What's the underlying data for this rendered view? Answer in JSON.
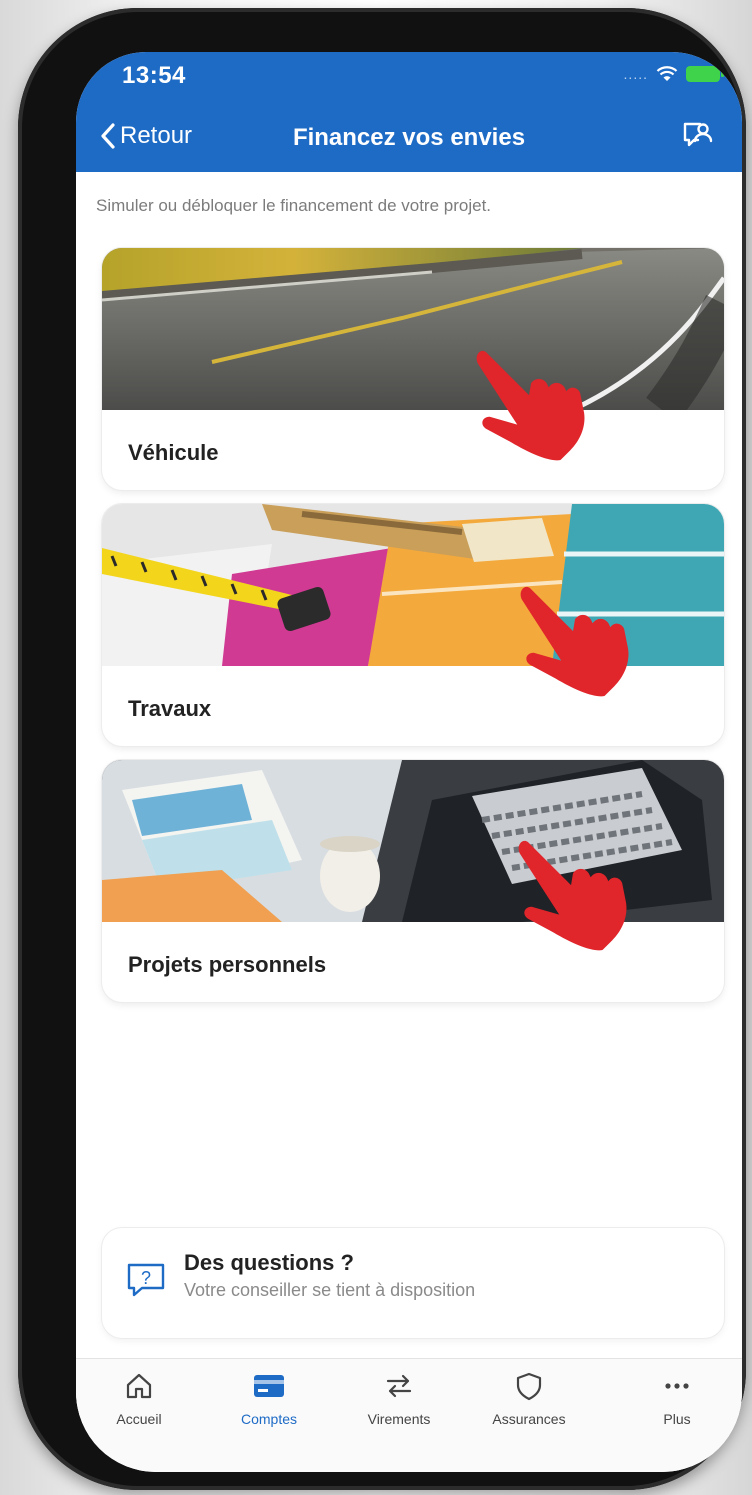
{
  "status": {
    "time": "13:54",
    "signal": "....."
  },
  "nav": {
    "back_label": "Retour",
    "title": "Financez vos envies"
  },
  "subtitle": "Simuler ou débloquer le financement de votre projet.",
  "cards": [
    {
      "label": "Véhicule",
      "image": "road-photo"
    },
    {
      "label": "Travaux",
      "image": "paint-samples-photo"
    },
    {
      "label": "Projets personnels",
      "image": "laptop-desk-photo"
    }
  ],
  "help": {
    "title": "Des questions ?",
    "subtitle": "Votre conseiller se tient à disposition",
    "icon": "question-bubble-icon"
  },
  "tabs": [
    {
      "label": "Accueil",
      "icon": "home-icon",
      "active": false
    },
    {
      "label": "Comptes",
      "icon": "card-icon",
      "active": true
    },
    {
      "label": "Virements",
      "icon": "transfer-icon",
      "active": false
    },
    {
      "label": "Assurances",
      "icon": "shield-icon",
      "active": false
    },
    {
      "label": "Plus",
      "icon": "more-icon",
      "active": false
    }
  ],
  "colors": {
    "brand": "#1e6bc6",
    "hand": "#e0252b",
    "battery": "#3fd24b"
  }
}
